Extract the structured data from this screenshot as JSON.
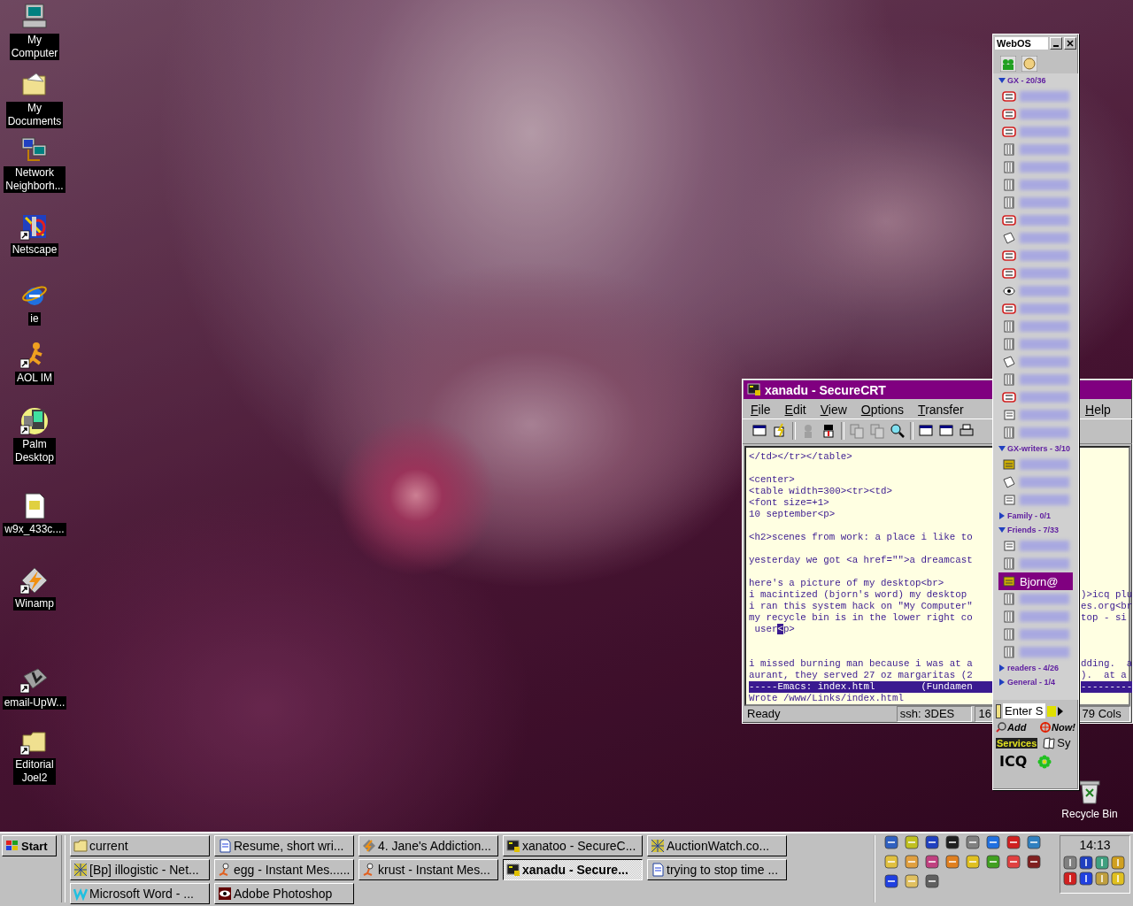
{
  "desktop_icons": [
    {
      "label": [
        "My",
        "Computer"
      ],
      "shortcut": false
    },
    {
      "label": [
        "My",
        "Documents"
      ],
      "shortcut": false
    },
    {
      "label": [
        "Network",
        "Neighborh..."
      ],
      "shortcut": false
    },
    {
      "label": [
        "Netscape"
      ],
      "shortcut": true
    },
    {
      "label": [
        "ie"
      ],
      "shortcut": false
    },
    {
      "label": [
        "AOL IM"
      ],
      "shortcut": true
    },
    {
      "label": [
        "Palm",
        "Desktop"
      ],
      "shortcut": true
    },
    {
      "label": [
        "w9x_433c...."
      ],
      "shortcut": false
    },
    {
      "label": [
        "Winamp"
      ],
      "shortcut": true
    },
    {
      "label": [
        "email-UpW..."
      ],
      "shortcut": true
    },
    {
      "label": [
        "Editorial",
        "Joel2"
      ],
      "shortcut": true
    }
  ],
  "recycle_bin": {
    "label": "Recycle Bin"
  },
  "securecrt": {
    "title": "xanadu - SecureCRT",
    "menu": [
      "File",
      "Edit",
      "View",
      "Options",
      "Transfer"
    ],
    "menu_right": [
      "Help"
    ],
    "lines": [
      {
        "kind": "text",
        "text": "</td></tr></table>"
      },
      {
        "kind": "blank"
      },
      {
        "kind": "text",
        "text": "<center>"
      },
      {
        "kind": "text",
        "text": "<table width=300><tr><td>"
      },
      {
        "kind": "text",
        "text": "<font size=+1>"
      },
      {
        "kind": "text",
        "text": "10 september<p>"
      },
      {
        "kind": "blank"
      },
      {
        "kind": "text",
        "text": "<h2>scenes from work: a place i like to"
      },
      {
        "kind": "blank"
      },
      {
        "kind": "text",
        "text": "yesterday we got <a href=\"\">a dreamcast"
      },
      {
        "kind": "blank"
      },
      {
        "kind": "text",
        "text": "here's a picture of my desktop<br>"
      },
      {
        "kind": "text",
        "text": "i macintized (bjorn's word) my desktop",
        "tail": ")>icq plu"
      },
      {
        "kind": "text",
        "text": "i ran this system hack on \"My Computer\"",
        "tail": "es.org<br"
      },
      {
        "kind": "text",
        "text": "my recycle bin is in the lower right co",
        "tail": "top - si"
      },
      {
        "kind": "cursor",
        "text": " user",
        "cursor": "<",
        "after": "p>"
      },
      {
        "kind": "blank"
      },
      {
        "kind": "blank"
      },
      {
        "kind": "text",
        "text": "i missed burning man because i was at a",
        "tail": "dding.  a"
      },
      {
        "kind": "text",
        "text": "aurant, they served 27 oz margaritas (2",
        "tail": ").  at a"
      },
      {
        "kind": "modeline",
        "text": "-----Emacs: index.html        (Fundamen",
        "tail": "---------"
      },
      {
        "kind": "text",
        "text": "Wrote /www/Links/index.html"
      }
    ],
    "status": [
      "Ready",
      "ssh: 3DES",
      "16"
    ],
    "status_right": "79 Cols"
  },
  "icq": {
    "title": "WebOS",
    "groups": [
      {
        "name": "GX - 20/36",
        "expanded": true,
        "contacts": [
          {
            "kind": "na",
            "selected": false
          },
          {
            "kind": "na",
            "selected": false
          },
          {
            "kind": "na",
            "selected": false
          },
          {
            "kind": "offline",
            "selected": false
          },
          {
            "kind": "offline",
            "selected": false
          },
          {
            "kind": "offline",
            "selected": false
          },
          {
            "kind": "offline",
            "selected": false
          },
          {
            "kind": "na",
            "selected": false
          },
          {
            "kind": "away",
            "selected": false
          },
          {
            "kind": "na",
            "selected": false
          },
          {
            "kind": "na",
            "selected": false
          },
          {
            "kind": "occupied",
            "selected": false
          },
          {
            "kind": "na",
            "selected": false
          },
          {
            "kind": "offline",
            "selected": false
          },
          {
            "kind": "offline",
            "selected": false
          },
          {
            "kind": "away",
            "selected": false
          },
          {
            "kind": "offline",
            "selected": false
          },
          {
            "kind": "na",
            "selected": false
          },
          {
            "kind": "note",
            "selected": false
          },
          {
            "kind": "offline",
            "selected": false
          }
        ]
      },
      {
        "name": "GX-writers - 3/10",
        "expanded": true,
        "contacts": [
          {
            "kind": "online",
            "selected": false
          },
          {
            "kind": "away",
            "selected": false
          },
          {
            "kind": "note",
            "selected": false
          }
        ]
      },
      {
        "name": "Family - 0/1",
        "expanded": false
      },
      {
        "name": "Friends - 7/33",
        "expanded": true,
        "contacts": [
          {
            "kind": "note",
            "selected": false
          },
          {
            "kind": "offline",
            "selected": false
          },
          {
            "kind": "online",
            "selected": true,
            "name": "Bjorn@"
          },
          {
            "kind": "offline",
            "selected": false
          },
          {
            "kind": "offline",
            "selected": false
          },
          {
            "kind": "offline",
            "selected": false
          },
          {
            "kind": "offline",
            "selected": false
          }
        ]
      },
      {
        "name": "readers - 4/26",
        "expanded": false
      },
      {
        "name": "General - 1/4",
        "expanded": false
      }
    ],
    "search": {
      "value": "Enter S"
    },
    "add": "Add",
    "now": "Now!",
    "services": "Services",
    "system": "Sy",
    "logo": "ICQ"
  },
  "taskbar": {
    "start": "Start",
    "tasks": [
      {
        "label": "current",
        "selected": false
      },
      {
        "label": "Resume, short wri...",
        "selected": false
      },
      {
        "label": "4. Jane's Addiction...",
        "selected": false
      },
      {
        "label": "xanatoo - SecureC...",
        "selected": false
      },
      {
        "label": "AuctionWatch.co...",
        "selected": false
      },
      {
        "label": "[Bp] illogistic - Net...",
        "selected": false
      },
      {
        "label": "egg - Instant Mes......",
        "selected": false
      },
      {
        "label": "krust - Instant Mes...",
        "selected": false
      },
      {
        "label": "xanadu - Secure...",
        "selected": true
      },
      {
        "label": "trying to stop time ...",
        "selected": false
      },
      {
        "label": "Microsoft Word - ...",
        "selected": false
      },
      {
        "label": "Adobe Photoshop",
        "selected": false
      }
    ],
    "clock": "14:13"
  }
}
